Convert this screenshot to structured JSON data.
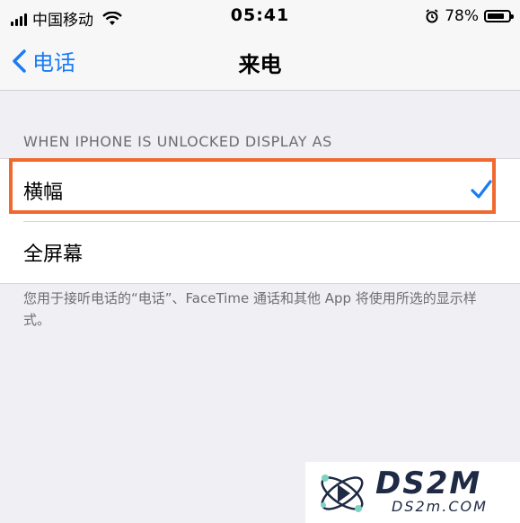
{
  "status_bar": {
    "carrier": "中国移动",
    "time": "05:41",
    "battery": "78%"
  },
  "nav": {
    "back_label": "电话",
    "title": "来电"
  },
  "section": {
    "header": "WHEN IPHONE IS UNLOCKED DISPLAY AS",
    "options": [
      {
        "label": "横幅",
        "selected": true
      },
      {
        "label": "全屏幕",
        "selected": false
      }
    ],
    "footer": "您用于接听电话的“电话”、FaceTime 通话和其他 App 将使用所选的显示样式。"
  },
  "watermark": {
    "brand": "DS2M",
    "domain": "DS2m.COM"
  },
  "colors": {
    "accent": "#1a7cf5",
    "highlight": "#f0692f"
  }
}
